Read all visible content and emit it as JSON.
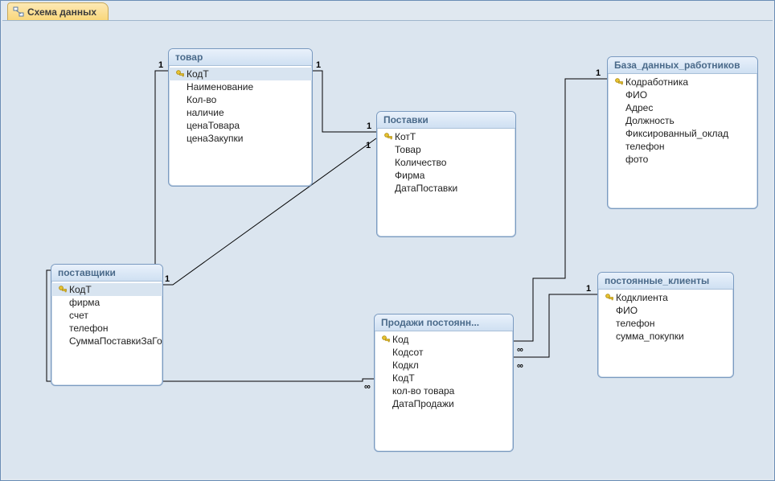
{
  "tab": {
    "title": "Схема данных"
  },
  "tables": {
    "tovar": {
      "title": "товар",
      "fields": [
        {
          "name": "КодТ",
          "pk": true,
          "selected": true
        },
        {
          "name": "Наименование",
          "pk": false
        },
        {
          "name": "Кол-во",
          "pk": false
        },
        {
          "name": "наличие",
          "pk": false
        },
        {
          "name": "ценаТовара",
          "pk": false
        },
        {
          "name": "ценаЗакупки",
          "pk": false
        }
      ]
    },
    "postavshchiki": {
      "title": "поставщики",
      "fields": [
        {
          "name": "КодТ",
          "pk": true,
          "selected": true
        },
        {
          "name": "фирма",
          "pk": false
        },
        {
          "name": "счет",
          "pk": false
        },
        {
          "name": "телефон",
          "pk": false
        },
        {
          "name": "СуммаПоставкиЗаГо",
          "pk": false
        }
      ]
    },
    "postavki": {
      "title": "Поставки",
      "fields": [
        {
          "name": "КотТ",
          "pk": true
        },
        {
          "name": "Товар",
          "pk": false
        },
        {
          "name": "Количество",
          "pk": false
        },
        {
          "name": "Фирма",
          "pk": false
        },
        {
          "name": "ДатаПоставки",
          "pk": false
        }
      ]
    },
    "prodazhi": {
      "title": "Продажи постоянн...",
      "fields": [
        {
          "name": "Код",
          "pk": true
        },
        {
          "name": "Кодсот",
          "pk": false
        },
        {
          "name": "Кодкл",
          "pk": false
        },
        {
          "name": "КодТ",
          "pk": false
        },
        {
          "name": "кол-во товара",
          "pk": false
        },
        {
          "name": "ДатаПродажи",
          "pk": false
        }
      ]
    },
    "rabotniki": {
      "title": "База_данных_работников",
      "fields": [
        {
          "name": "Кодработника",
          "pk": true
        },
        {
          "name": "ФИО",
          "pk": false
        },
        {
          "name": "Адрес",
          "pk": false
        },
        {
          "name": "Должность",
          "pk": false
        },
        {
          "name": "Фиксированный_оклад",
          "pk": false
        },
        {
          "name": "телефон",
          "pk": false
        },
        {
          "name": "фото",
          "pk": false
        }
      ]
    },
    "klienty": {
      "title": "постоянные_клиенты",
      "fields": [
        {
          "name": "Кодклиента",
          "pk": true
        },
        {
          "name": "ФИО",
          "pk": false
        },
        {
          "name": "телефон",
          "pk": false
        },
        {
          "name": "сумма_покупки",
          "pk": false
        }
      ]
    }
  },
  "relationships": [
    {
      "from": "tovar.КодТ",
      "to": "postavki",
      "type": "1-1"
    },
    {
      "from": "postavshchiki.КодТ",
      "to": "postavki",
      "type": "1-1"
    },
    {
      "from": "tovar.КодТ",
      "to": "prodazhi.КодТ",
      "type": "1-∞"
    },
    {
      "from": "rabotniki.Кодработника",
      "to": "prodazhi.Кодсот",
      "type": "1-∞"
    },
    {
      "from": "klienty.Кодклиента",
      "to": "prodazhi.Кодкл",
      "type": "1-∞"
    }
  ],
  "labels": {
    "one": "1",
    "many": "∞"
  }
}
